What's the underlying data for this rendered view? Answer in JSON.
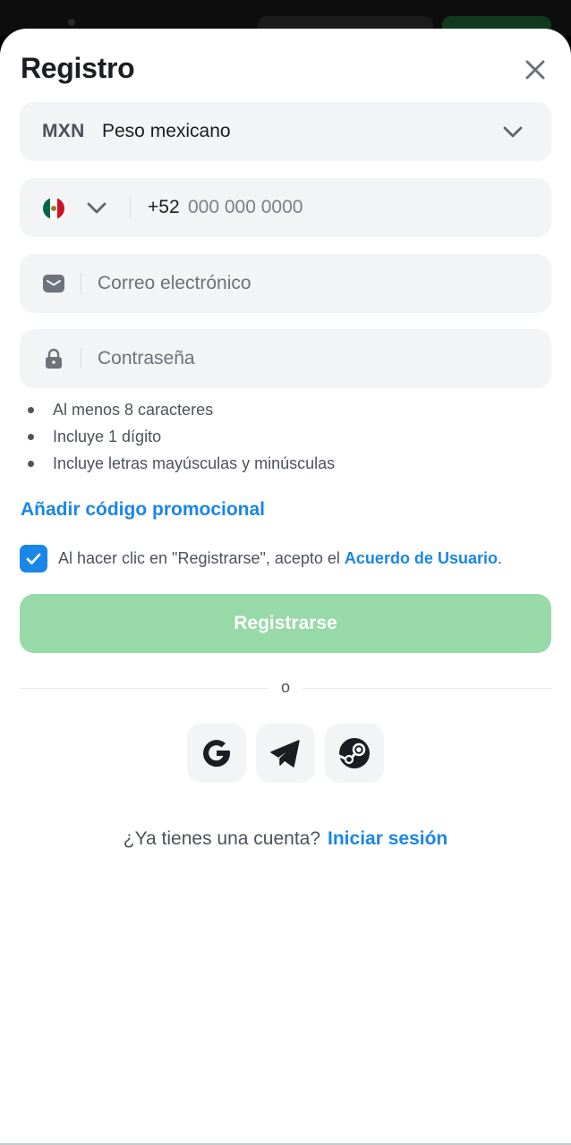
{
  "header": {
    "title": "Registro",
    "close_icon": "close-icon"
  },
  "currency": {
    "code": "MXN",
    "name": "Peso mexicano"
  },
  "phone": {
    "country_flag": "mexico-flag",
    "prefix": "+52",
    "placeholder": "000 000 0000"
  },
  "email": {
    "placeholder": "Correo electrónico",
    "icon": "envelope-icon"
  },
  "password": {
    "placeholder": "Contraseña",
    "icon": "lock-icon"
  },
  "password_rules": [
    "Al menos 8 caracteres",
    "Incluye 1 dígito",
    "Incluye letras mayúsculas y minúsculas"
  ],
  "promo": {
    "label": "Añadir código promocional"
  },
  "agreement": {
    "checked": true,
    "text": "Al hacer clic en \"Registrarse\", acepto el ",
    "link": "Acuerdo de Usuario",
    "suffix": "."
  },
  "submit": {
    "label": "Registrarse"
  },
  "divider": {
    "label": "o"
  },
  "social": [
    {
      "name": "google",
      "icon": "google-icon"
    },
    {
      "name": "telegram",
      "icon": "telegram-icon"
    },
    {
      "name": "steam",
      "icon": "steam-icon"
    }
  ],
  "footer": {
    "question": "¿Ya tienes una cuenta?",
    "login_label": "Iniciar sesión"
  },
  "colors": {
    "accent": "#1a86e8",
    "submit_disabled": "#98d9a8",
    "field_bg": "#f3f4f6"
  }
}
